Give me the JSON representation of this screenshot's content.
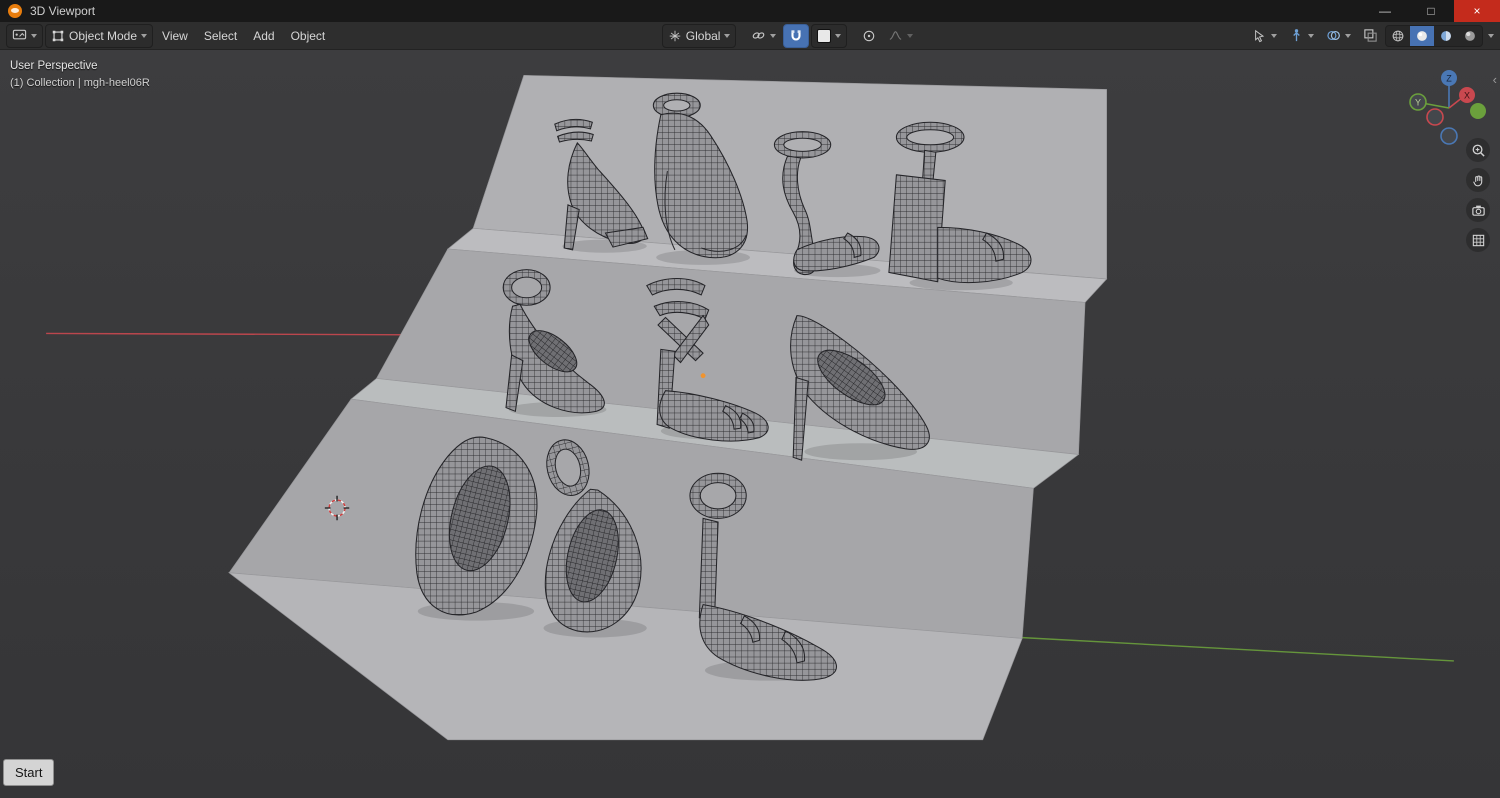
{
  "titlebar": {
    "title": "3D Viewport",
    "minimize_glyph": "—",
    "maximize_glyph": "□",
    "close_glyph": "×"
  },
  "header": {
    "mode_label": "Object Mode",
    "menus": [
      {
        "label": "View"
      },
      {
        "label": "Select"
      },
      {
        "label": "Add"
      },
      {
        "label": "Object"
      }
    ],
    "orientation_label": "Global"
  },
  "viewport": {
    "view_label": "User Perspective",
    "breadcrumb": "(1) Collection | mgh-heel06R",
    "start_label": "Start",
    "sidebar_toggle_glyph": "‹",
    "axis_labels": {
      "x": "X",
      "y": "Y",
      "z": "Z"
    }
  },
  "colors": {
    "accent_blue": "#4772b3",
    "axis_x_red": "#c9484f",
    "axis_y_green": "#6ba03c",
    "axis_z_blue": "#4a78b5",
    "neg_axis_fill": "#44474c",
    "platform_gray": "#b5b5b8",
    "viewport_bg": "#3a3a3c",
    "blender_orange": "#e87d0d",
    "origin_orange": "#f0942f",
    "close_red": "#c42b1c"
  }
}
